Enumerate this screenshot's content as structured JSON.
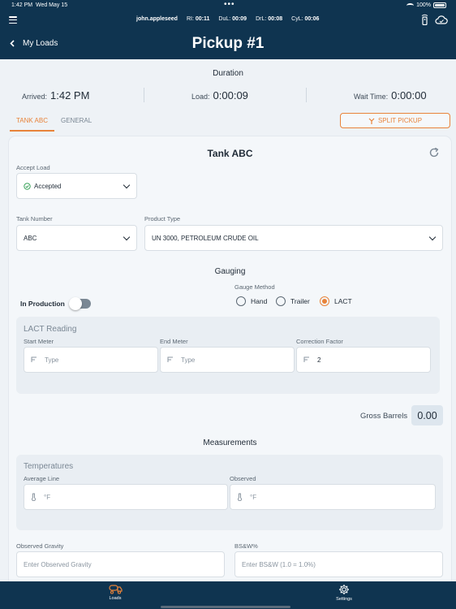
{
  "status": {
    "time": "1:42 PM",
    "date": "Wed May 15",
    "battery": "100%"
  },
  "header": {
    "user": "john.appleseed",
    "metrics": [
      {
        "label": "RI:",
        "value": "00:11"
      },
      {
        "label": "DuL:",
        "value": "00:09"
      },
      {
        "label": "DrL:",
        "value": "00:08"
      },
      {
        "label": "CyL:",
        "value": "00:06"
      }
    ],
    "back_label": "My Loads",
    "title": "Pickup #1"
  },
  "duration": {
    "title": "Duration",
    "arrived_label": "Arrived:",
    "arrived_value": "1:42 PM",
    "load_label": "Load:",
    "load_value": "0:00:09",
    "wait_label": "Wait Time:",
    "wait_value": "0:00:00"
  },
  "tabs": [
    {
      "label": "TANK ABC"
    },
    {
      "label": "GENERAL"
    }
  ],
  "split_pickup_label": "SPLIT PICKUP",
  "card": {
    "title": "Tank ABC",
    "accept_load_label": "Accept Load",
    "accept_load_value": "Accepted",
    "tank_number_label": "Tank Number",
    "tank_number_value": "ABC",
    "product_type_label": "Product Type",
    "product_type_value": "UN 3000, PETROLEUM CRUDE OIL",
    "gauging_title": "Gauging",
    "in_production_label": "In Production",
    "gauge_method_label": "Gauge Method",
    "gauge_methods": [
      {
        "label": "Hand"
      },
      {
        "label": "Trailer"
      },
      {
        "label": "LACT"
      }
    ],
    "gauge_method_selected": "LACT",
    "lact": {
      "title": "LACT Reading",
      "start_meter_label": "Start Meter",
      "start_meter_placeholder": "Type",
      "end_meter_label": "End Meter",
      "end_meter_placeholder": "Type",
      "correction_factor_label": "Correction Factor",
      "correction_factor_value": "2"
    },
    "gross_barrels_label": "Gross Barrels",
    "gross_barrels_value": "0.00",
    "measurements_title": "Measurements",
    "temperatures": {
      "title": "Temperatures",
      "average_line_label": "Average Line",
      "average_line_unit": "°F",
      "observed_label": "Observed",
      "observed_unit": "°F"
    },
    "observed_gravity_label": "Observed Gravity",
    "observed_gravity_placeholder": "Enter Observed Gravity",
    "bsw_label": "BS&W%",
    "bsw_placeholder": "Enter BS&W (1.0 = 1.0%)"
  },
  "bottom_nav": [
    {
      "label": "Loads"
    },
    {
      "label": "Settings"
    }
  ],
  "colors": {
    "header_bg": "#0f3450",
    "accent": "#e8833a",
    "page_bg": "#eef2f6",
    "accepted_green": "#3aa35a"
  }
}
